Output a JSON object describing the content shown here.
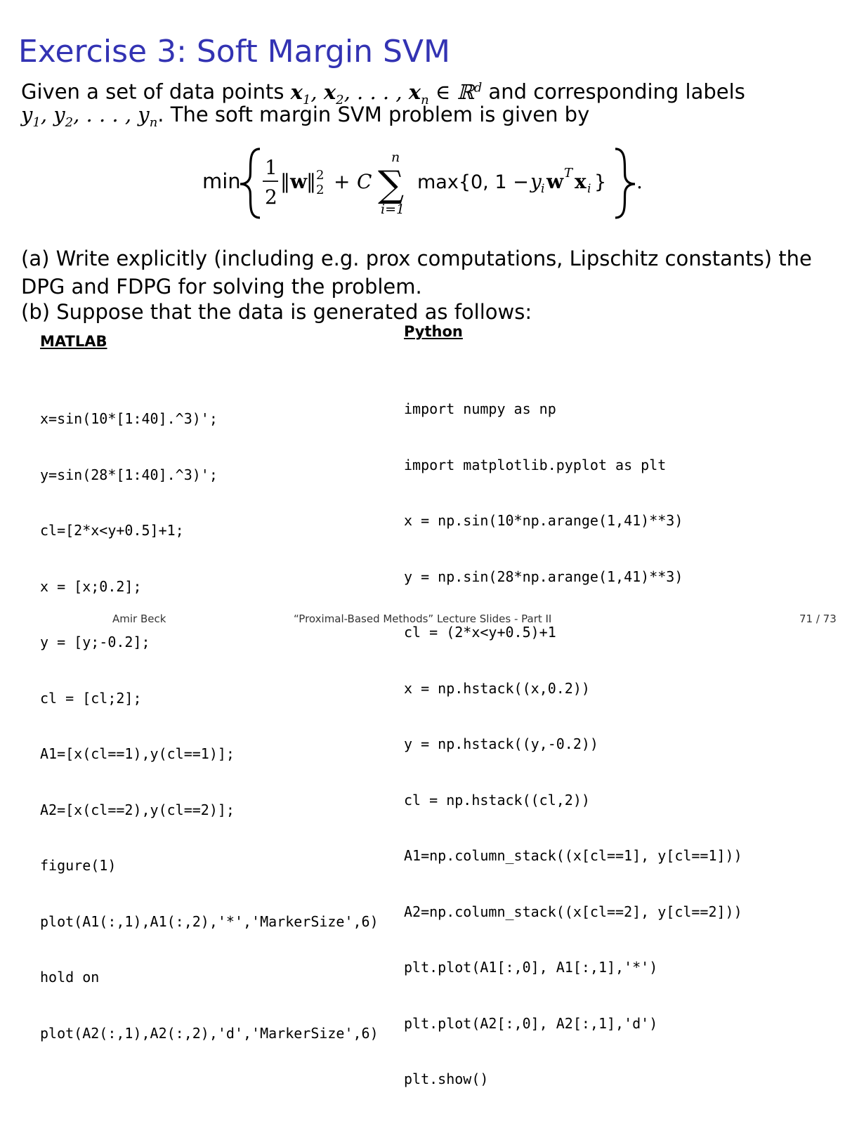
{
  "slide": {
    "title": "Exercise 3: Soft Margin SVM",
    "intro": {
      "line1_a": "Given a set of data points ",
      "line1_b": " and corresponding labels",
      "line2_b": ". The soft margin SVM problem is given by"
    },
    "formula": {
      "min": "min",
      "half_num": "1",
      "half_den": "2",
      "plus": "+",
      "C": "C",
      "sum_top": "n",
      "sum_bottom": "i=1",
      "max_text": "max{0, 1 − ",
      "close": "}",
      "period": "."
    },
    "part_a_line1": "(a) Write explicitly (including e.g. prox computations, Lipschitz constants) the",
    "part_a_line2": "DPG and FDPG for solving the problem.",
    "part_b": "(b) Suppose that the data is generated as follows:"
  },
  "matlab": {
    "heading": "MATLAB",
    "lines": [
      "x=sin(10*[1:40].^3)';",
      "y=sin(28*[1:40].^3)';",
      "cl=[2*x<y+0.5]+1;",
      "x = [x;0.2];",
      "y = [y;-0.2];",
      "cl = [cl;2];",
      "A1=[x(cl==1),y(cl==1)];",
      "A2=[x(cl==2),y(cl==2)];",
      "figure(1)",
      "plot(A1(:,1),A1(:,2),'*','MarkerSize',6)",
      "hold on",
      "plot(A2(:,1),A2(:,2),'d','MarkerSize',6)"
    ]
  },
  "python": {
    "heading": "Python",
    "lines": [
      "import numpy as np",
      "import matplotlib.pyplot as plt",
      "x = np.sin(10*np.arange(1,41)**3)",
      "y = np.sin(28*np.arange(1,41)**3)",
      "cl = (2*x<y+0.5)+1",
      "x = np.hstack((x,0.2))",
      "y = np.hstack((y,-0.2))",
      "cl = np.hstack((cl,2))",
      "A1=np.column_stack((x[cl==1], y[cl==1]))",
      "A2=np.column_stack((x[cl==2], y[cl==2]))",
      "plt.plot(A1[:,0], A1[:,1],'*')",
      "plt.plot(A2[:,0], A2[:,1],'d')",
      "plt.show()"
    ]
  },
  "footer": {
    "author": "Amir Beck",
    "title": "“Proximal-Based Methods” Lecture Slides - Part II",
    "page": "71 / 73"
  },
  "colors": {
    "title": "#3333b3",
    "text": "#000000"
  }
}
